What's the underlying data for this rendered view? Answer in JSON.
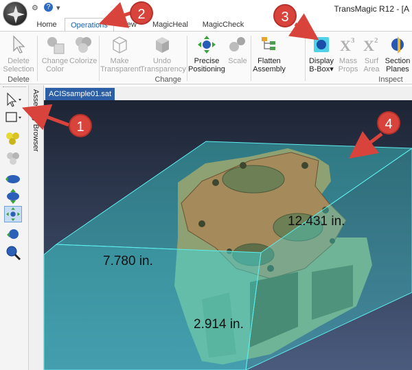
{
  "window": {
    "title": "TransMagic R12 - [A"
  },
  "quick_access": {
    "gear_icon": "gear-icon",
    "help_icon": "help-icon",
    "more": "▾"
  },
  "tabs": [
    {
      "label": "Home",
      "active": false
    },
    {
      "label": "Operations",
      "active": true
    },
    {
      "label": "View",
      "active": false
    },
    {
      "label": "MagicHeal",
      "active": false
    },
    {
      "label": "MagicCheck",
      "active": false
    }
  ],
  "ribbon": {
    "delete_selection": {
      "line1": "Delete",
      "line2": "Selection"
    },
    "change_color": {
      "line1": "Change",
      "line2": "Color"
    },
    "colorize": {
      "line1": "Colorize",
      "line2": ""
    },
    "make_transparent": {
      "line1": "Make",
      "line2": "Transparent"
    },
    "undo_transparency": {
      "line1": "Undo",
      "line2": "Transparency"
    },
    "precise_positioning": {
      "line1": "Precise",
      "line2": "Positioning"
    },
    "scale": {
      "line1": "Scale",
      "line2": ""
    },
    "flatten_assembly": {
      "line1": "Flatten",
      "line2": "Assembly"
    },
    "display_bbox": {
      "line1": "Display",
      "line2": "B-Box▾"
    },
    "mass_props": {
      "line1": "Mass",
      "line2": "Props"
    },
    "surf_area": {
      "line1": "Surf",
      "line2": "Area"
    },
    "section_planes": {
      "line1": "Section",
      "line2": "Planes"
    },
    "groups": {
      "delete": "Delete",
      "change": "Change",
      "inspect": "Inspect"
    }
  },
  "sidebar": {
    "assembly_browser": "Assembly Browser"
  },
  "document": {
    "tab_label": "ACISsample01.sat"
  },
  "dimensions": {
    "length": "12.431 in.",
    "width": "7.780 in.",
    "height": "2.914 in."
  },
  "callouts": [
    "1",
    "2",
    "3",
    "4"
  ],
  "colors": {
    "accent": "#2d5fa6",
    "callout": "#d8433c",
    "bbox": "#3fd6d6",
    "part": "#8a9a6a"
  }
}
